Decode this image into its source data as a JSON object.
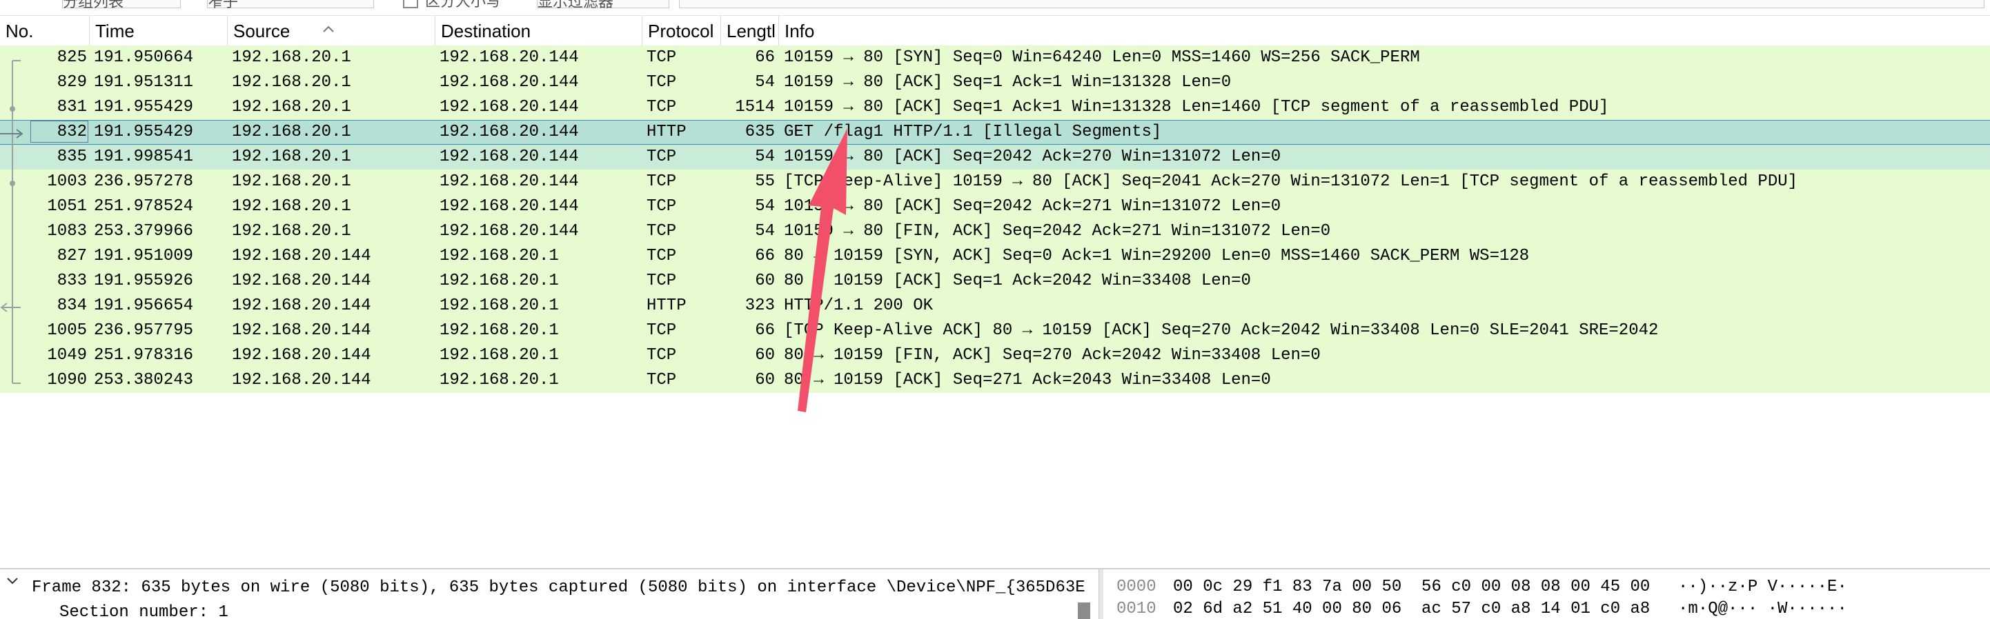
{
  "colors": {
    "tcp_row_bg": "#e7fbd0",
    "http_row_bg": "#e7fbd0",
    "selected_row_bg": "#b5e1d5",
    "selected_border": "#3d88b8",
    "annotation_arrow": "#f2506a"
  },
  "filter_bar": {
    "control1_text": "分组列表",
    "control2_text": "窄子",
    "checkbox_label": "区分大小写",
    "control3_text": "显示过滤器"
  },
  "columns": [
    {
      "key": "no",
      "label": "No."
    },
    {
      "key": "time",
      "label": "Time"
    },
    {
      "key": "source",
      "label": "Source"
    },
    {
      "key": "destination",
      "label": "Destination"
    },
    {
      "key": "protocol",
      "label": "Protocol"
    },
    {
      "key": "length",
      "label": "Lengtl"
    },
    {
      "key": "info",
      "label": "Info"
    }
  ],
  "sort_icon": "sort-ascending-caret-icon",
  "packets": [
    {
      "no": "825",
      "time": "191.950664",
      "source": "192.168.20.1",
      "destination": "192.168.20.144",
      "protocol": "TCP",
      "length": "66",
      "info": "10159 → 80 [SYN] Seq=0 Win=64240 Len=0 MSS=1460 WS=256 SACK_PERM"
    },
    {
      "no": "829",
      "time": "191.951311",
      "source": "192.168.20.1",
      "destination": "192.168.20.144",
      "protocol": "TCP",
      "length": "54",
      "info": "10159 → 80 [ACK] Seq=1 Ack=1 Win=131328 Len=0"
    },
    {
      "no": "831",
      "time": "191.955429",
      "source": "192.168.20.1",
      "destination": "192.168.20.144",
      "protocol": "TCP",
      "length": "1514",
      "info": "10159 → 80 [ACK] Seq=1 Ack=1 Win=131328 Len=1460 [TCP segment of a reassembled PDU]"
    },
    {
      "no": "832",
      "time": "191.955429",
      "source": "192.168.20.1",
      "destination": "192.168.20.144",
      "protocol": "HTTP",
      "length": "635",
      "info": "GET /flag1 HTTP/1.1 [Illegal Segments]",
      "selected": true
    },
    {
      "no": "835",
      "time": "191.998541",
      "source": "192.168.20.1",
      "destination": "192.168.20.144",
      "protocol": "TCP",
      "length": "54",
      "info": "10159 → 80 [ACK] Seq=2042 Ack=270 Win=131072 Len=0",
      "related": true
    },
    {
      "no": "1003",
      "time": "236.957278",
      "source": "192.168.20.1",
      "destination": "192.168.20.144",
      "protocol": "TCP",
      "length": "55",
      "info": "[TCP Keep-Alive] 10159 → 80 [ACK] Seq=2041 Ack=270 Win=131072 Len=1 [TCP segment of a reassembled PDU]"
    },
    {
      "no": "1051",
      "time": "251.978524",
      "source": "192.168.20.1",
      "destination": "192.168.20.144",
      "protocol": "TCP",
      "length": "54",
      "info": "10159 → 80 [ACK] Seq=2042 Ack=271 Win=131072 Len=0"
    },
    {
      "no": "1083",
      "time": "253.379966",
      "source": "192.168.20.1",
      "destination": "192.168.20.144",
      "protocol": "TCP",
      "length": "54",
      "info": "10159 → 80 [FIN, ACK] Seq=2042 Ack=271 Win=131072 Len=0"
    },
    {
      "no": "827",
      "time": "191.951009",
      "source": "192.168.20.144",
      "destination": "192.168.20.1",
      "protocol": "TCP",
      "length": "66",
      "info": "80 → 10159 [SYN, ACK] Seq=0 Ack=1 Win=29200 Len=0 MSS=1460 SACK_PERM WS=128"
    },
    {
      "no": "833",
      "time": "191.955926",
      "source": "192.168.20.144",
      "destination": "192.168.20.1",
      "protocol": "TCP",
      "length": "60",
      "info": "80 → 10159 [ACK] Seq=1 Ack=2042 Win=33408 Len=0"
    },
    {
      "no": "834",
      "time": "191.956654",
      "source": "192.168.20.144",
      "destination": "192.168.20.1",
      "protocol": "HTTP",
      "length": "323",
      "info": "HTTP/1.1 200 OK"
    },
    {
      "no": "1005",
      "time": "236.957795",
      "source": "192.168.20.144",
      "destination": "192.168.20.1",
      "protocol": "TCP",
      "length": "66",
      "info": "[TCP Keep-Alive ACK] 80 → 10159 [ACK] Seq=270 Ack=2042 Win=33408 Len=0 SLE=2041 SRE=2042"
    },
    {
      "no": "1049",
      "time": "251.978316",
      "source": "192.168.20.144",
      "destination": "192.168.20.1",
      "protocol": "TCP",
      "length": "60",
      "info": "80 → 10159 [FIN, ACK] Seq=270 Ack=2042 Win=33408 Len=0"
    },
    {
      "no": "1090",
      "time": "253.380243",
      "source": "192.168.20.144",
      "destination": "192.168.20.1",
      "protocol": "TCP",
      "length": "60",
      "info": "80 → 10159 [ACK] Seq=271 Ack=2043 Win=33408 Len=0"
    }
  ],
  "detail": {
    "expand_icon": "chevron-down-icon",
    "frame_summary": "Frame 832: 635 bytes on wire (5080 bits), 635 bytes captured (5080 bits) on interface \\Device\\NPF_{365D63E",
    "section_number": "Section number: 1"
  },
  "hex": [
    {
      "offset": "0000",
      "bytes": "00 0c 29 f1 83 7a 00 50  56 c0 00 08 08 00 45 00",
      "ascii": "··)··z·P V·····E·"
    },
    {
      "offset": "0010",
      "bytes": "02 6d a2 51 40 00 80 06  ac 57 c0 a8 14 01 c0 a8",
      "ascii": "·m·Q@··· ·W······"
    }
  ]
}
